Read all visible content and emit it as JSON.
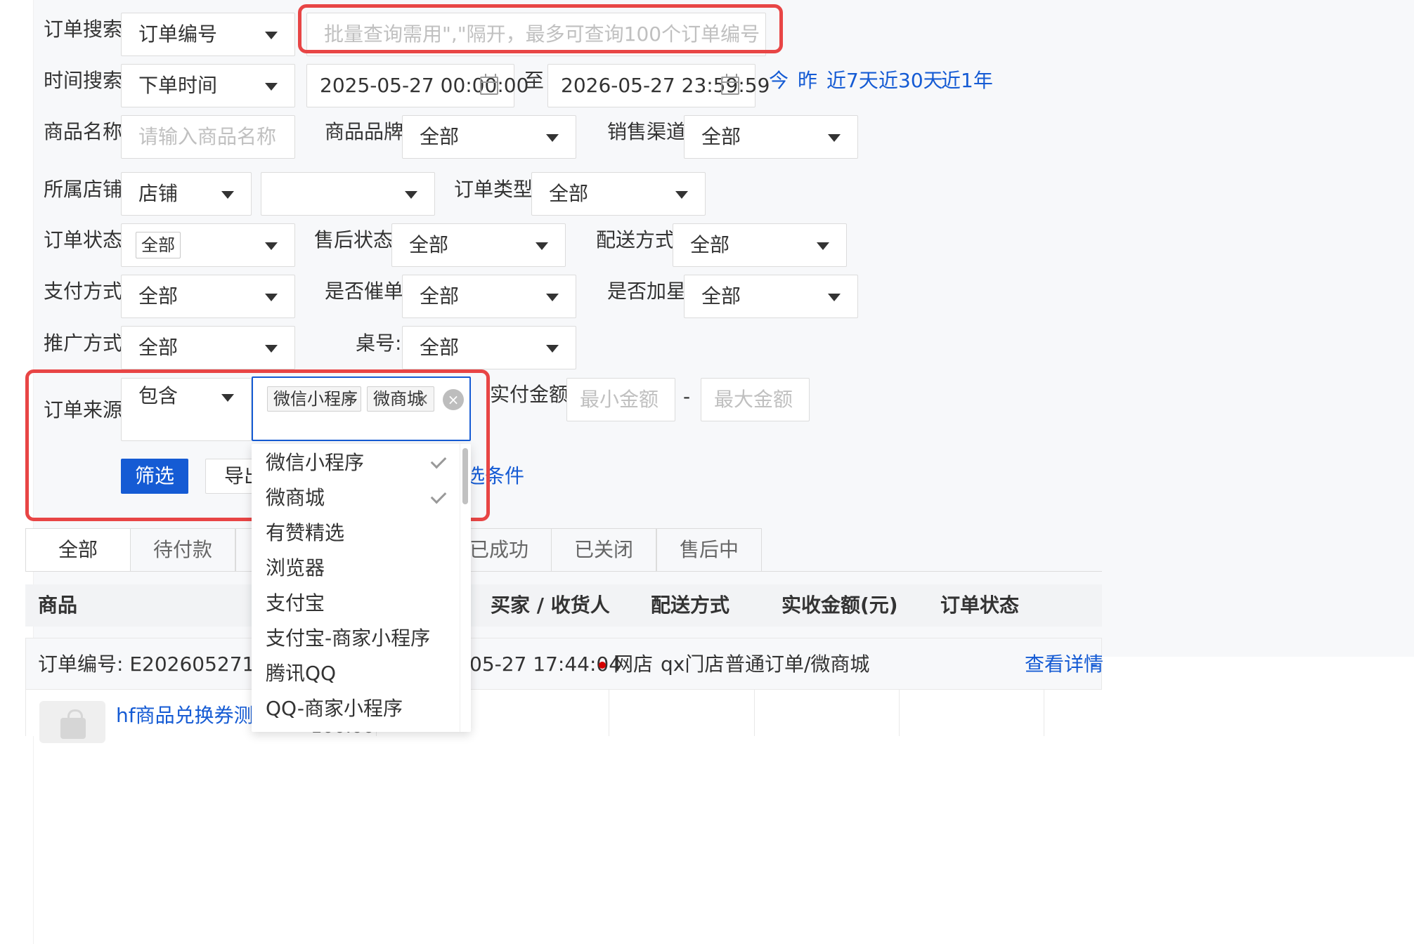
{
  "filters": {
    "order_search": {
      "label": "订单搜索:",
      "type_value": "订单编号",
      "placeholder": "批量查询需用\",\"隔开，最多可查询100个订单编号"
    },
    "time_search": {
      "label": "时间搜索:",
      "type_value": "下单时间",
      "start": "2025-05-27 00:00:00",
      "to": "至",
      "end": "2026-05-27 23:59:59",
      "quick": [
        "今",
        "昨",
        "近7天",
        "近30天",
        "近1年"
      ]
    },
    "product_name": {
      "label": "商品名称:",
      "placeholder": "请输入商品名称"
    },
    "brand": {
      "label": "商品品牌:",
      "value": "全部"
    },
    "channel": {
      "label": "销售渠道:",
      "value": "全部"
    },
    "store": {
      "label": "所属店铺:",
      "type_value": "店铺",
      "value": ""
    },
    "order_type": {
      "label": "订单类型:",
      "value": "全部"
    },
    "order_status": {
      "label": "订单状态:",
      "value": "全部"
    },
    "after_sale": {
      "label": "售后状态:",
      "value": "全部"
    },
    "delivery": {
      "label": "配送方式:",
      "value": "全部"
    },
    "payment": {
      "label": "支付方式:",
      "value": "全部"
    },
    "urge": {
      "label": "是否催单:",
      "value": "全部"
    },
    "star": {
      "label": "是否加星:",
      "value": "全部"
    },
    "promo": {
      "label": "推广方式:",
      "value": "全部"
    },
    "table_no": {
      "label": "桌号:",
      "value": "全部"
    },
    "source": {
      "label": "订单来源:",
      "mode": "包含",
      "tags": [
        "微信小程序",
        "微商城"
      ]
    },
    "amount": {
      "label": "实付金额:",
      "min_placeholder": "最小金额",
      "dash": "-",
      "max_placeholder": "最大金额"
    }
  },
  "actions": {
    "filter": "筛选",
    "export_partial": "导出",
    "clear_partial": "选条件"
  },
  "dropdown": {
    "options": [
      "微信小程序",
      "微商城",
      "有赞精选",
      "浏览器",
      "支付宝",
      "支付宝-商家小程序",
      "腾讯QQ",
      "QQ-商家小程序"
    ],
    "selected": [
      true,
      true,
      false,
      false,
      false,
      false,
      false,
      false
    ]
  },
  "tabs": [
    "全部",
    "待付款",
    "",
    "",
    "已成功",
    "已关闭",
    "售后中"
  ],
  "table": {
    "headers": {
      "product": "商品",
      "buyer": "买家 / 收货人",
      "delivery": "配送方式",
      "amount": "实收金额(元)",
      "status": "订单状态"
    }
  },
  "order": {
    "number": "订单编号: E20260527174403",
    "time": "05-27 17:44:04",
    "store_type": "网店",
    "store": "qx门店",
    "kind": "普通订单/微商城",
    "detail_link": "查看详情",
    "detail_tail": "-",
    "product": "hf商品兑换券测试00",
    "price_partial": "100.00"
  },
  "colors": {
    "accent": "#155bd4",
    "highlight": "#e84545"
  }
}
